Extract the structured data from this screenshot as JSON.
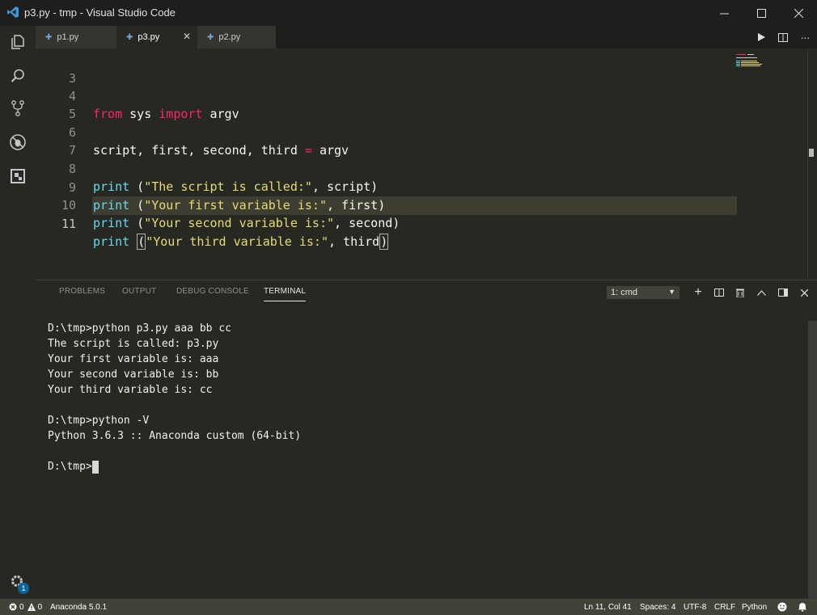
{
  "window": {
    "title": "p3.py - tmp - Visual Studio Code"
  },
  "tabs": [
    {
      "label": "p1.py",
      "active": false
    },
    {
      "label": "p3.py",
      "active": true
    },
    {
      "label": "p2.py",
      "active": false
    }
  ],
  "editor": {
    "current_line": "11",
    "lines": [
      {
        "num": "3"
      },
      {
        "num": "4",
        "t1": "from",
        "t2": " sys ",
        "t3": "import",
        "t4": " argv"
      },
      {
        "num": "5"
      },
      {
        "num": "6",
        "t1": "script, first, second, third ",
        "t2": "=",
        "t3": " argv"
      },
      {
        "num": "7"
      },
      {
        "num": "8",
        "t1": "print",
        "t2": " (",
        "t3": "\"The script is called:\"",
        "t4": ", script)"
      },
      {
        "num": "9",
        "t1": "print",
        "t2": " (",
        "t3": "\"Your first variable is:\"",
        "t4": ", first)"
      },
      {
        "num": "10",
        "t1": "print",
        "t2": " (",
        "t3": "\"Your second variable is:\"",
        "t4": ", second)"
      },
      {
        "num": "11",
        "t1": "print",
        "t2": " ",
        "t2b": "(",
        "t3": "\"Your third variable is:\"",
        "t4": ", third",
        "t5": ")"
      }
    ]
  },
  "panel": {
    "tabs": [
      "PROBLEMS",
      "OUTPUT",
      "DEBUG CONSOLE",
      "TERMINAL"
    ],
    "active_tab": "TERMINAL",
    "terminal_select": "1: cmd",
    "terminal_lines": [
      "D:\\tmp>python p3.py aaa bb cc",
      "The script is called: p3.py",
      "Your first variable is: aaa",
      "Your second variable is: bb",
      "Your third variable is: cc",
      "",
      "D:\\tmp>python -V",
      "Python 3.6.3 :: Anaconda custom (64-bit)",
      "",
      "D:\\tmp>"
    ]
  },
  "statusbar": {
    "errors": "0",
    "warnings": "0",
    "interpreter": "Anaconda 5.0.1",
    "position": "Ln 11, Col 41",
    "spaces": "Spaces: 4",
    "encoding": "UTF-8",
    "eol": "CRLF",
    "language": "Python"
  },
  "activity": {
    "settings_badge": "1"
  },
  "icons": {
    "app": "vscode-logo-icon",
    "activity": [
      "explorer-icon",
      "search-icon",
      "source-control-icon",
      "debug-icon",
      "extensions-icon",
      "gear-icon"
    ],
    "tab_actions": [
      "run-icon",
      "split-editor-icon",
      "more-icon"
    ],
    "panel_actions": [
      "add-terminal-icon",
      "split-terminal-icon",
      "trash-icon",
      "maximize-panel-icon",
      "panel-layout-icon",
      "close-panel-icon"
    ]
  },
  "colors": {
    "keyword": "#f92672",
    "function": "#66d9ef",
    "string": "#e6db74",
    "background": "#272822",
    "statusbar": "#414339"
  }
}
